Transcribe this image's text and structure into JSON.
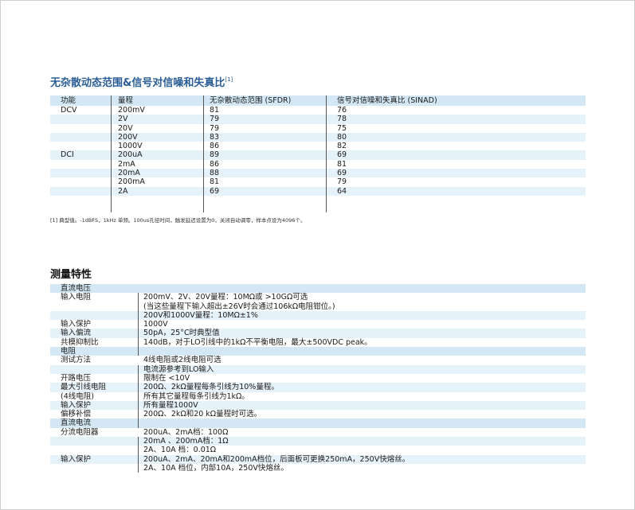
{
  "section1": {
    "title": "无杂散动态范围&信号对信噪和失真比",
    "title_sup": "[1]",
    "headers": [
      "功能",
      "量程",
      "无杂散动态范围 (SFDR)",
      "信号对信噪和失真比 (SINAD)"
    ],
    "rows": [
      [
        "DCV",
        "200mV",
        "81",
        "76"
      ],
      [
        "",
        "2V",
        "79",
        "78"
      ],
      [
        "",
        "20V",
        "79",
        "75"
      ],
      [
        "",
        "200V",
        "83",
        "80"
      ],
      [
        "",
        "1000V",
        "86",
        "82"
      ],
      [
        "DCI",
        "200uA",
        "89",
        "69"
      ],
      [
        "",
        "2mA",
        "86",
        "81"
      ],
      [
        "",
        "20mA",
        "88",
        "69"
      ],
      [
        "",
        "200mA",
        "81",
        "79"
      ],
      [
        "",
        "2A",
        "69",
        "64"
      ]
    ],
    "footnote": "[1] 典型值。-1dBFS，1kHz 单频。100us孔径时间，触发延迟设置为0，关闭自动调零，样本点设为4096个。"
  },
  "section2": {
    "title": "测量特性",
    "rows": [
      {
        "type": "sec",
        "k": "直流电压",
        "v": ""
      },
      {
        "type": "row",
        "k": "输入电阻",
        "v": "200mV、2V、20V量程：10MΩ或 >10GΩ可选"
      },
      {
        "type": "row",
        "k": "",
        "v": "(当这些量程下输入超出±26V时会通过106kΩ电阻钳位。)"
      },
      {
        "type": "row",
        "k": "",
        "v": "200V和1000V量程：10MΩ±1%"
      },
      {
        "type": "row",
        "k": "输入保护",
        "v": "1000V"
      },
      {
        "type": "row",
        "k": "输入偏流",
        "v": "50pA，25°C时典型值"
      },
      {
        "type": "row",
        "k": "共模抑制比",
        "v": "140dB，对于LO引线中的1kΩ不平衡电阻，最大±500VDC peak。"
      },
      {
        "type": "sec",
        "k": "电阻",
        "v": ""
      },
      {
        "type": "row",
        "k": "测试方法",
        "v": "4线电阻或2线电阻可选"
      },
      {
        "type": "row",
        "k": "",
        "v": "电流源参考到LO输入"
      },
      {
        "type": "row",
        "k": "开路电压",
        "v": "限制在 <10V"
      },
      {
        "type": "row",
        "k": "最大引线电阻",
        "v": "200Ω、2kΩ量程每条引线为10%量程。"
      },
      {
        "type": "row",
        "k": "(4线电阻)",
        "v": "所有其它量程每条引线为1kΩ。"
      },
      {
        "type": "row",
        "k": "输入保护",
        "v": "所有量程1000V"
      },
      {
        "type": "row",
        "k": "偏移补偿",
        "v": "200Ω、2kΩ和20 kΩ量程时可选。"
      },
      {
        "type": "sec",
        "k": "直流电流",
        "v": ""
      },
      {
        "type": "row",
        "k": "分流电阻器",
        "v": "200uA、2mA档：100Ω"
      },
      {
        "type": "row",
        "k": "",
        "v": "20mA 、200mA档：1Ω"
      },
      {
        "type": "row",
        "k": "",
        "v": "2A、10A 档：0.01Ω"
      },
      {
        "type": "row",
        "k": "输入保护",
        "v": "200uA、2mA、20mA和200mA档位，后面板可更换250mA，250V快熔丝。"
      },
      {
        "type": "row",
        "k": "",
        "v": "2A、10A 档位，内部10A，250V快熔丝。"
      }
    ]
  }
}
